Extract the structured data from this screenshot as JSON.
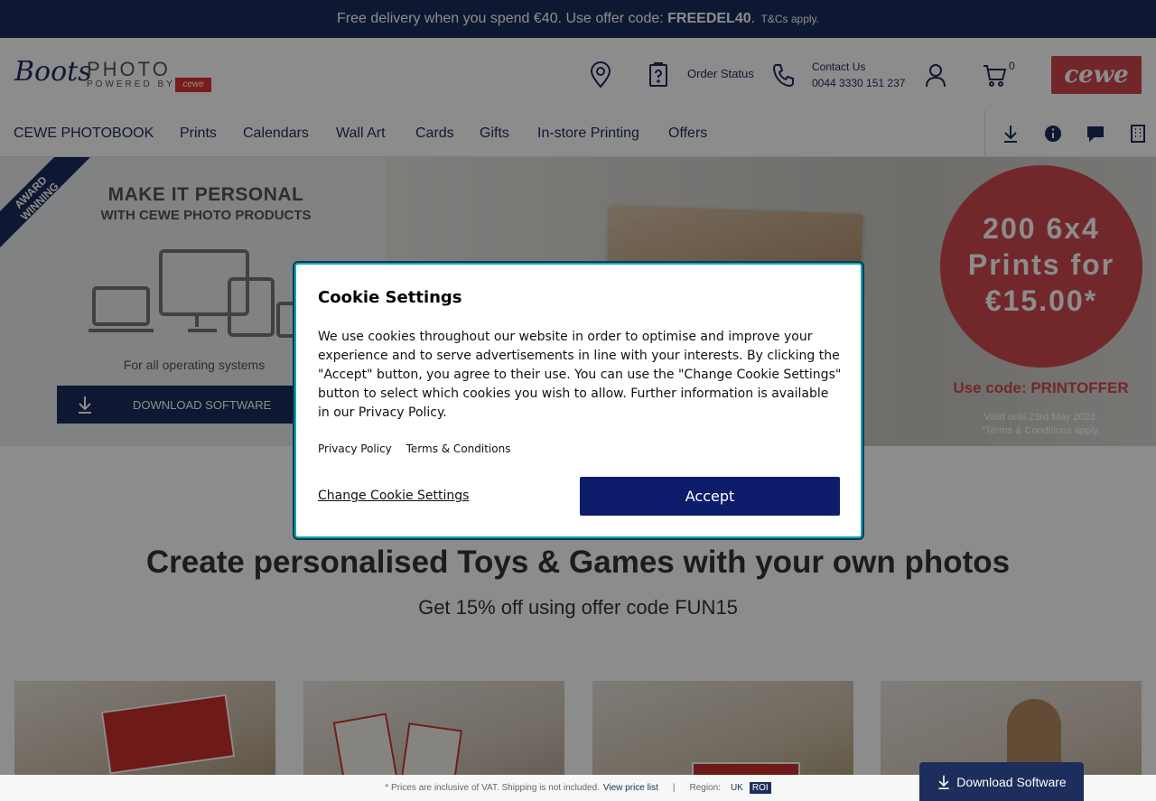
{
  "promo": {
    "text_pre": "Free delivery when you spend €40. Use offer code: ",
    "code": "FREEDEL40",
    "text_post": ".",
    "terms": "T&Cs apply."
  },
  "header": {
    "logo_brand": "Boots",
    "logo_photo": "PHOTO",
    "logo_powered": "POWERED BY",
    "logo_cewe_mini": "cewe",
    "order_status": "Order Status",
    "contact_label": "Contact Us",
    "contact_phone": "0044 3330 151 237",
    "cart_count": "0",
    "cewe_logo": "cewe"
  },
  "nav": {
    "items": [
      "CEWE PHOTOBOOK",
      "Prints",
      "Calendars",
      "Wall Art",
      "Cards",
      "Gifts",
      "In-store Printing",
      "Offers"
    ]
  },
  "hero": {
    "award": "AWARD WINNING",
    "title": "MAKE IT PERSONAL",
    "subtitle": "WITH CEWE PHOTO PRODUCTS",
    "os_text": "For all operating systems",
    "download_btn": "DOWNLOAD SOFTWARE",
    "badge_line1": "200 6x4",
    "badge_line2": "Prints for",
    "badge_line3": "€15.00*",
    "code_line": "Use code: PRINTOFFER",
    "valid_line1": "Valid until 23rd May 2023.",
    "valid_line2": "*Terms & Conditions apply."
  },
  "section": {
    "title": "Create personalised Toys & Games with your own photos",
    "subtitle": "Get 15% off using offer code FUN15"
  },
  "footer": {
    "vat_note": "* Prices are inclusive of VAT. Shipping is not included.",
    "price_list": "View price list",
    "separator": "|",
    "region_label": "Region:",
    "region_uk": "UK",
    "region_roi": "ROI",
    "download_sticky": "Download Software"
  },
  "cookie_modal": {
    "title": "Cookie Settings",
    "body": "We use cookies throughout our website in order to optimise and improve your experience and to serve advertisements in line with your interests. By clicking the \"Accept\" button, you agree to their use. You can use the \"Change Cookie Settings\" button to select which cookies you wish to allow. Further information is available in our Privacy Policy.",
    "privacy_link": "Privacy Policy",
    "terms_link": "Terms & Conditions",
    "change_settings": "Change Cookie Settings",
    "accept": "Accept"
  },
  "colors": {
    "brand_navy": "#1d2d5c",
    "cewe_red": "#d0454e",
    "accept_blue": "#0e1d6b",
    "modal_focus": "#1aa"
  }
}
